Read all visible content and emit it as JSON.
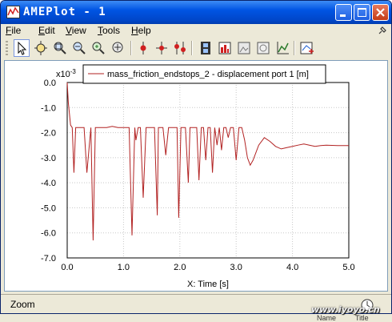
{
  "window": {
    "title": "AMEPlot - 1"
  },
  "menu": [
    {
      "label": "File",
      "key": "F",
      "rest": "ile"
    },
    {
      "label": "Edit",
      "key": "E",
      "rest": "dit"
    },
    {
      "label": "View",
      "key": "V",
      "rest": "iew"
    },
    {
      "label": "Tools",
      "key": "T",
      "rest": "ools"
    },
    {
      "label": "Help",
      "key": "H",
      "rest": "elp"
    }
  ],
  "toolbar": {
    "tools": [
      "select-arrow-icon",
      "zoom-fit-icon",
      "zoom-window-icon",
      "zoom-out-icon",
      "zoom-x-icon",
      "pan-icon",
      "marker-icon",
      "cross-marker-icon",
      "multi-marker-icon",
      "film-icon",
      "bar-chart-icon",
      "image-icon",
      "snapshot-icon",
      "chart-axes-icon",
      "add-plot-icon"
    ]
  },
  "statusbar": {
    "text": "Zoom"
  },
  "bottom_strip": {
    "name": "Name",
    "title": "Title"
  },
  "watermark": "www.iyoyo.cn",
  "colors": {
    "series": "#b22222",
    "title_bar": "#0054e3",
    "face": "#ece9d8"
  },
  "chart_data": {
    "type": "line",
    "y_scale_label": "x10-3",
    "y_scale_base": "x10",
    "y_scale_exp": "-3",
    "xlabel": "X: Time [s]",
    "ylabel": "",
    "xlim": [
      0,
      5
    ],
    "ylim": [
      -7,
      0
    ],
    "xticks": [
      "0.0",
      "1.0",
      "2.0",
      "3.0",
      "4.0",
      "5.0"
    ],
    "yticks": [
      "0.0",
      "-1.0",
      "-2.0",
      "-3.0",
      "-4.0",
      "-5.0",
      "-6.0",
      "-7.0"
    ],
    "grid": true,
    "legend": "top",
    "series": [
      {
        "name": "mass_friction_endstops_2 - displacement port 1 [m]",
        "x": [
          0,
          0.02,
          0.06,
          0.09,
          0.12,
          0.15,
          0.2,
          0.26,
          0.3,
          0.35,
          0.42,
          0.46,
          0.5,
          0.55,
          0.6,
          0.7,
          0.8,
          0.9,
          1.0,
          1.05,
          1.1,
          1.15,
          1.2,
          1.22,
          1.26,
          1.3,
          1.35,
          1.4,
          1.45,
          1.5,
          1.55,
          1.6,
          1.62,
          1.66,
          1.7,
          1.75,
          1.8,
          1.85,
          1.9,
          1.95,
          1.98,
          2.02,
          2.06,
          2.1,
          2.15,
          2.18,
          2.22,
          2.26,
          2.3,
          2.34,
          2.38,
          2.42,
          2.46,
          2.5,
          2.54,
          2.58,
          2.62,
          2.66,
          2.7,
          2.74,
          2.78,
          2.82,
          2.86,
          2.9,
          2.95,
          3.0,
          3.05,
          3.1,
          3.15,
          3.2,
          3.25,
          3.3,
          3.4,
          3.5,
          3.6,
          3.7,
          3.8,
          3.9,
          4.0,
          4.1,
          4.2,
          4.3,
          4.4,
          4.5,
          4.6,
          4.8,
          5.0
        ],
        "values": [
          0,
          -0.8,
          -1.7,
          -1.8,
          -3.6,
          -1.8,
          -1.8,
          -1.8,
          -1.8,
          -3.6,
          -1.8,
          -6.3,
          -1.8,
          -1.8,
          -1.8,
          -1.8,
          -1.75,
          -1.8,
          -1.8,
          -1.8,
          -1.8,
          -6.1,
          -1.8,
          -2.3,
          -1.8,
          -1.8,
          -4.6,
          -1.8,
          -1.8,
          -1.8,
          -1.8,
          -5.3,
          -1.8,
          -1.8,
          -1.8,
          -2.9,
          -1.8,
          -1.8,
          -1.8,
          -1.8,
          -5.4,
          -1.8,
          -1.8,
          -1.8,
          -4.0,
          -1.8,
          -1.8,
          -1.8,
          -1.8,
          -3.9,
          -1.8,
          -1.8,
          -3.1,
          -1.8,
          -1.8,
          -3.6,
          -1.8,
          -2.5,
          -1.8,
          -2.7,
          -1.8,
          -1.8,
          -2.2,
          -1.8,
          -1.8,
          -3.1,
          -1.8,
          -1.8,
          -2.3,
          -3.0,
          -3.3,
          -3.1,
          -2.5,
          -2.2,
          -2.35,
          -2.55,
          -2.65,
          -2.6,
          -2.55,
          -2.5,
          -2.45,
          -2.5,
          -2.55,
          -2.52,
          -2.5,
          -2.52,
          -2.52
        ]
      }
    ]
  }
}
